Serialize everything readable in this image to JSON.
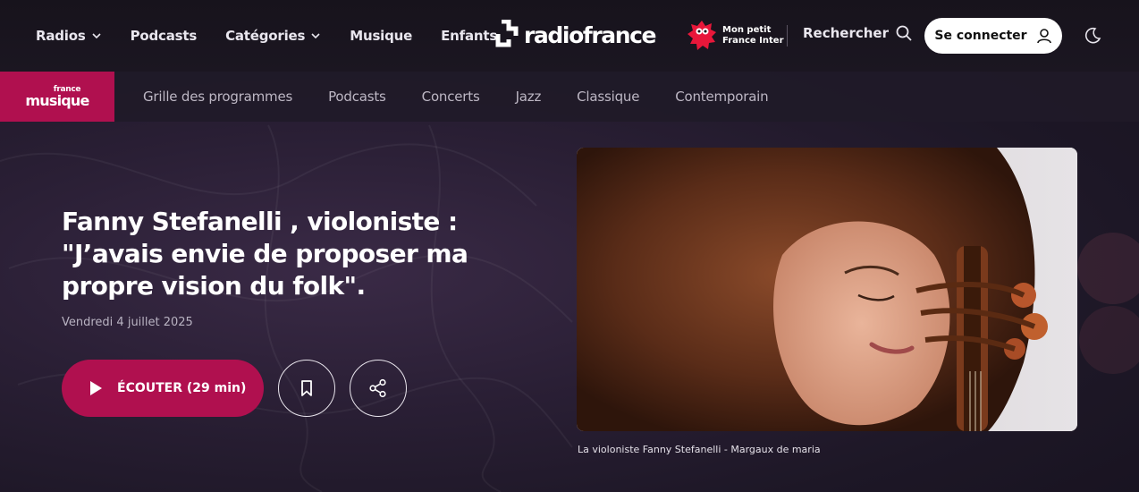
{
  "topnav": {
    "items": [
      {
        "label": "Radios",
        "dropdown": true
      },
      {
        "label": "Podcasts",
        "dropdown": false
      },
      {
        "label": "Catégories",
        "dropdown": true
      },
      {
        "label": "Musique",
        "dropdown": false
      },
      {
        "label": "Enfants",
        "dropdown": false
      }
    ],
    "brand": "radiofrance",
    "kids_brand_line1": "Mon petit",
    "kids_brand_line2": "France Inter",
    "search_label": "Rechercher",
    "login_label": "Se connecter",
    "icons": [
      "chevron-down-icon",
      "radiofrance-logo-icon",
      "mascot-icon",
      "search-icon",
      "user-icon",
      "moon-icon"
    ]
  },
  "subnav": {
    "logo_small": "france",
    "logo_big": "musique",
    "items": [
      "Grille des programmes",
      "Podcasts",
      "Concerts",
      "Jazz",
      "Classique",
      "Contemporain"
    ]
  },
  "hero": {
    "title": "Fanny Stefanelli , violoniste : \"J’avais envie de proposer ma propre vision du folk\".",
    "date": "Vendredi 4 juillet 2025",
    "listen_label": "ÉCOUTER",
    "duration": "(29 min)",
    "icons": [
      "play-icon",
      "bookmark-icon",
      "share-icon"
    ],
    "caption": "La violoniste Fanny Stefanelli - Margaux de maria"
  },
  "colors": {
    "accent": "#b0104f",
    "background": "#241c2e",
    "topbar": "#17131c"
  }
}
